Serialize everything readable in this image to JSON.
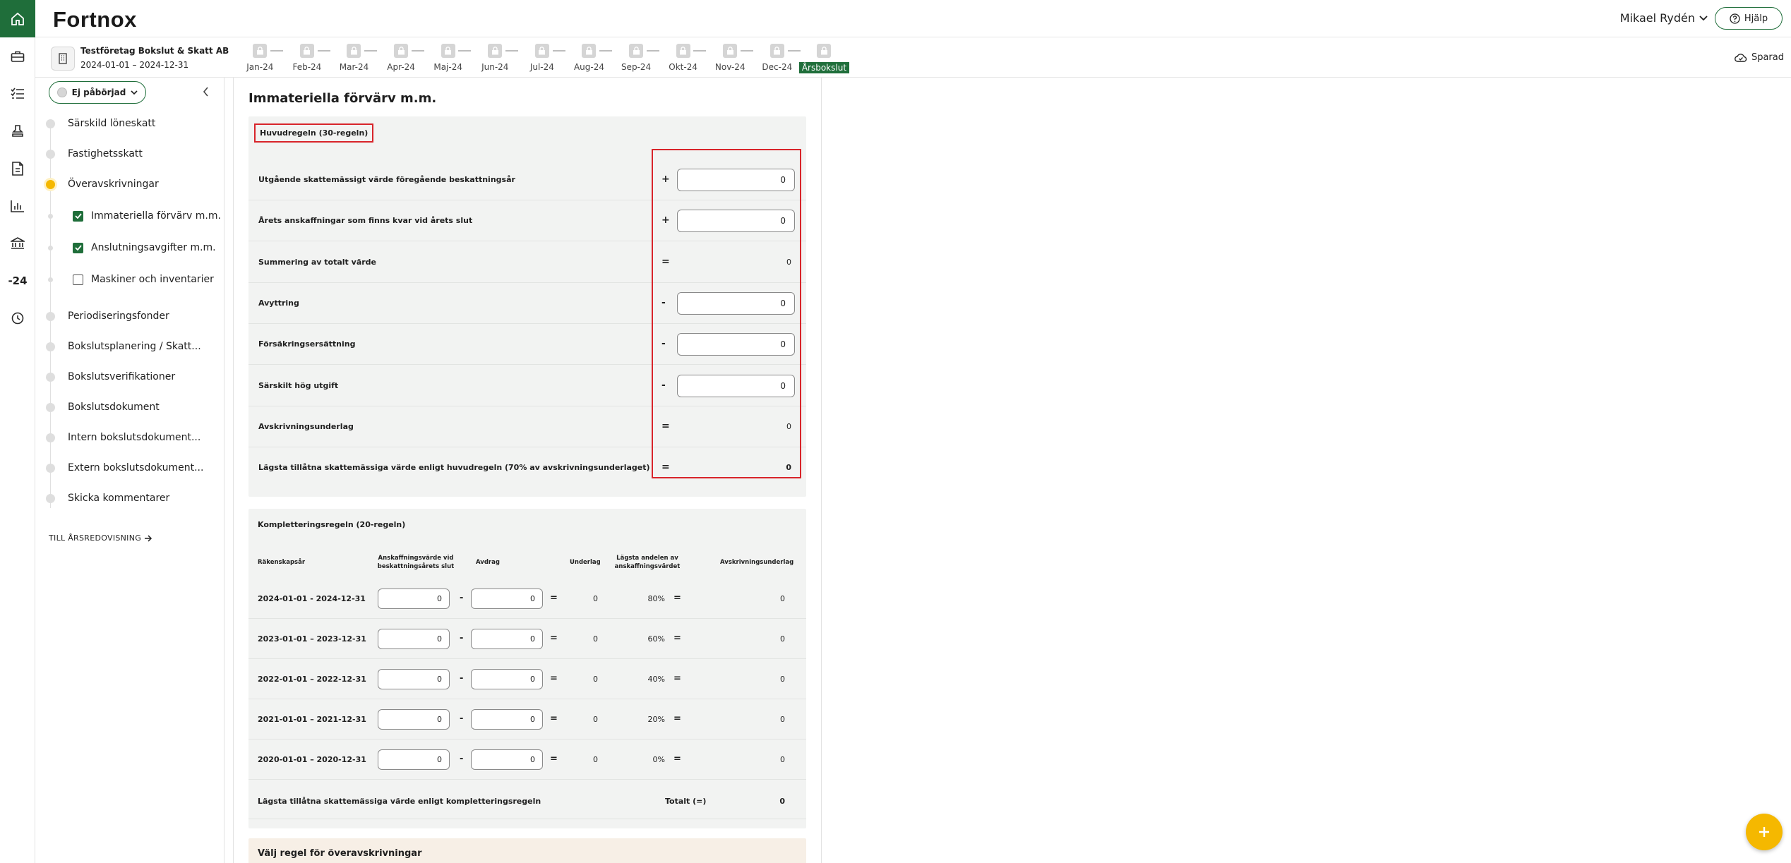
{
  "app": {
    "logo": "Fortnox",
    "user_name": "Mikael Rydén",
    "help_label": "Hjälp",
    "saved_label": "Sparad",
    "rail_year_label": "-24"
  },
  "company": {
    "name": "Testföretag Bokslut & Skatt AB",
    "period": "2024-01-01 – 2024-12-31"
  },
  "months": [
    "Jan-24",
    "Feb-24",
    "Mar-24",
    "Apr-24",
    "Maj-24",
    "Jun-24",
    "Jul-24",
    "Aug-24",
    "Sep-24",
    "Okt-24",
    "Nov-24",
    "Dec-24",
    "Årsbokslut"
  ],
  "sidebar": {
    "status": "Ej påbörjad",
    "items": [
      {
        "label": "Särskild löneskatt"
      },
      {
        "label": "Fastighetsskatt"
      },
      {
        "label": "Överavskrivningar"
      },
      {
        "label": "Immateriella förvärv m.m."
      },
      {
        "label": "Anslutningsavgifter m.m."
      },
      {
        "label": "Maskiner och inventarier"
      },
      {
        "label": "Periodiseringsfonder"
      },
      {
        "label": "Bokslutsplanering / Skatt..."
      },
      {
        "label": "Bokslutsverifikationer"
      },
      {
        "label": "Bokslutsdokument"
      },
      {
        "label": "Intern bokslutsdokument..."
      },
      {
        "label": "Extern bokslutsdokument..."
      },
      {
        "label": "Skicka kommentarer"
      }
    ],
    "to_report": "TILL ÅRSREDOVISNING"
  },
  "main": {
    "title": "Immateriella förvärv m.m.",
    "huvudregel": {
      "title": "Huvudregeln (30-regeln)",
      "rows": [
        {
          "label": "Utgående skattemässigt värde föregående beskattningsår",
          "op": "+",
          "value": "0"
        },
        {
          "label": "Årets anskaffningar som finns kvar vid årets slut",
          "op": "+",
          "value": "0"
        },
        {
          "label": "Summering av totalt värde",
          "op": "=",
          "value": "0"
        },
        {
          "label": "Avyttring",
          "op": "-",
          "value": "0"
        },
        {
          "label": "Försäkringsersättning",
          "op": "-",
          "value": "0"
        },
        {
          "label": "Särskilt hög utgift",
          "op": "-",
          "value": "0"
        },
        {
          "label": "Avskrivningsunderlag",
          "op": "=",
          "value": "0"
        },
        {
          "label": "Lägsta tillåtna skattemässiga värde enligt huvudregeln (70% av avskrivningsunderlaget)",
          "op": "=",
          "value": "0"
        }
      ]
    },
    "komplettering": {
      "title": "Kompletteringsregeln (20-regeln)",
      "headers": {
        "period": "Räkenskapsår",
        "anskaffning_1": "Anskaffningsvärde vid",
        "anskaffning_2": "beskattningsårets slut",
        "avdrag": "Avdrag",
        "underlag": "Underlag",
        "lagsta_1": "Lägsta andelen av",
        "lagsta_2": "anskaffningsvärdet",
        "avskrivning": "Avskrivningsunderlag"
      },
      "rows": [
        {
          "period": "2024-01-01 - 2024-12-31",
          "anskaffning": "0",
          "avdrag": "0",
          "underlag": "0",
          "pct": "80%",
          "result": "0"
        },
        {
          "period": "2023-01-01 – 2023-12-31",
          "anskaffning": "0",
          "avdrag": "0",
          "underlag": "0",
          "pct": "60%",
          "result": "0"
        },
        {
          "period": "2022-01-01 – 2022-12-31",
          "anskaffning": "0",
          "avdrag": "0",
          "underlag": "0",
          "pct": "40%",
          "result": "0"
        },
        {
          "period": "2021-01-01 – 2021-12-31",
          "anskaffning": "0",
          "avdrag": "0",
          "underlag": "0",
          "pct": "20%",
          "result": "0"
        },
        {
          "period": "2020-01-01 – 2020-12-31",
          "anskaffning": "0",
          "avdrag": "0",
          "underlag": "0",
          "pct": "0%",
          "result": "0"
        }
      ],
      "total_label": "Lägsta tillåtna skattemässiga värde enligt kompletteringsregeln",
      "total_text": "Totalt (=)",
      "total_value": "0",
      "minus": "-",
      "equals": "="
    },
    "choose_rule_title": "Välj regel för överavskrivningar"
  },
  "colors": {
    "brand_green": "#1f6e3a",
    "highlight_red": "#d8242a",
    "active_yellow": "#f5b800"
  }
}
